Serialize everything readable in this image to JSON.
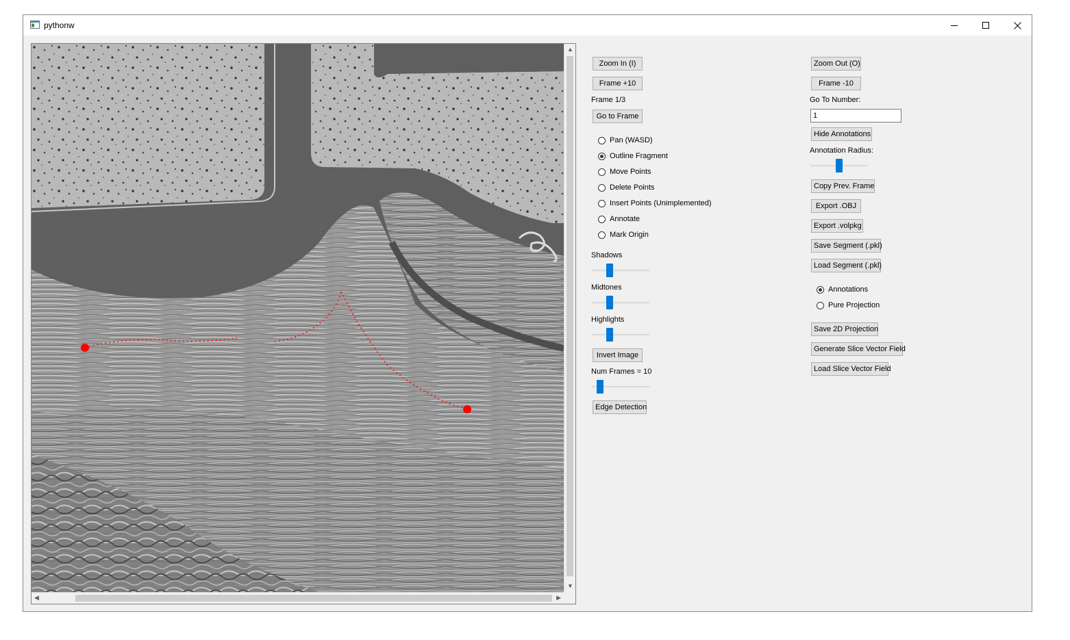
{
  "window": {
    "title": "pythonw",
    "icons": {
      "app": "app-window-icon",
      "minimize": "minimize-icon",
      "maximize": "maximize-icon",
      "close": "close-icon"
    }
  },
  "viewer": {
    "image": "scroll-ct-slice",
    "annotation_color": "#ff0000",
    "scrollbars": {
      "vertical_arrow_up": "▲",
      "vertical_arrow_down": "▼",
      "horizontal_arrow_left": "◀",
      "horizontal_arrow_right": "▶"
    }
  },
  "left_panel": {
    "zoom_in": "Zoom In (I)",
    "frame_plus": "Frame +10",
    "frame_status": "Frame 1/3",
    "go_to_frame": "Go to Frame",
    "modes": [
      {
        "label": "Pan (WASD)",
        "selected": false
      },
      {
        "label": "Outline Fragment",
        "selected": true
      },
      {
        "label": "Move Points",
        "selected": false
      },
      {
        "label": "Delete Points",
        "selected": false
      },
      {
        "label": "Insert Points (Unimplemented)",
        "selected": false
      },
      {
        "label": "Annotate",
        "selected": false
      },
      {
        "label": "Mark Origin",
        "selected": false
      }
    ],
    "shadows_label": "Shadows",
    "midtones_label": "Midtones",
    "highlights_label": "Highlights",
    "invert_image": "Invert Image",
    "num_frames_label": "Num Frames = 10",
    "edge_detection": "Edge Detection",
    "slider_levels": {
      "shadows": 0.28,
      "midtones": 0.28,
      "highlights": 0.28,
      "num_frames": 0.1
    }
  },
  "right_panel": {
    "zoom_out": "Zoom Out (O)",
    "frame_minus": "Frame -10",
    "go_to_number_label": "Go To Number:",
    "go_to_number_value": "1",
    "hide_annotations": "Hide Annotations",
    "annotation_radius_label": "Annotation Radius:",
    "annotation_radius_level": 0.5,
    "copy_prev_frame": "Copy Prev. Frame",
    "export_obj": "Export .OBJ",
    "export_volpkg": "Export .volpkg",
    "save_segment": "Save Segment (.pkl)",
    "load_segment": "Load Segment (.pkl)",
    "view_modes": [
      {
        "label": "Annotations",
        "selected": true
      },
      {
        "label": "Pure Projection",
        "selected": false
      }
    ],
    "save_2d_projection": "Save 2D Projection",
    "generate_slice_vector_field": "Generate Slice Vector Field",
    "load_slice_vector_field": "Load Slice Vector Field"
  }
}
